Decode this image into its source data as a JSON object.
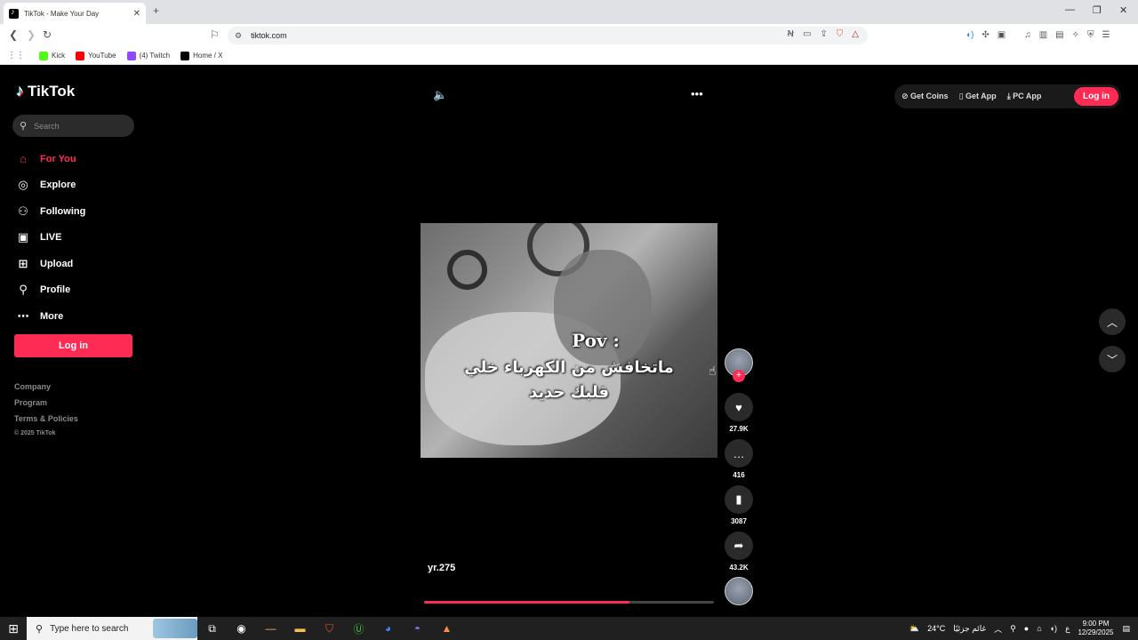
{
  "browser": {
    "tab_title": "TikTok - Make Your Day",
    "tab_close": "✕",
    "new_tab": "+",
    "url": "tiktok.com",
    "bookmarks": [
      {
        "label": "Kick",
        "color": "#53fc18"
      },
      {
        "label": "YouTube",
        "color": "#ff0000"
      },
      {
        "label": "(4) Twitch",
        "color": "#9146ff"
      },
      {
        "label": "Home / X",
        "color": "#000000"
      }
    ]
  },
  "sidebar": {
    "logo": "TikTok",
    "search_placeholder": "Search",
    "nav": [
      {
        "label": "For You",
        "icon": "home-icon"
      },
      {
        "label": "Explore",
        "icon": "compass-icon"
      },
      {
        "label": "Following",
        "icon": "following-icon"
      },
      {
        "label": "LIVE",
        "icon": "live-icon"
      },
      {
        "label": "Upload",
        "icon": "upload-icon"
      },
      {
        "label": "Profile",
        "icon": "profile-icon"
      },
      {
        "label": "More",
        "icon": "more-icon"
      }
    ],
    "login": "Log in",
    "footer": [
      "Company",
      "Program",
      "Terms & Policies"
    ],
    "copyright": "© 2025 TikTok"
  },
  "top_actions": {
    "get_coins": "Get Coins",
    "get_app": "Get App",
    "pc_app": "PC App",
    "login": "Log in"
  },
  "video": {
    "caption_line1": "Pov :",
    "caption_line2": "ماتخافش من الكهرباء خلي",
    "caption_line3": "قلبك حديد",
    "author": "yr.275",
    "description_emoji": "😀",
    "progress_fraction": 0.71
  },
  "actions": {
    "likes": "27.9K",
    "comments": "416",
    "saves": "3087",
    "shares": "43.2K"
  },
  "taskbar": {
    "search_placeholder": "Type here to search",
    "weather": "24°C",
    "weather_text": "غائم جزئيًا",
    "time": "9:00 PM",
    "date": "12/29/2025"
  },
  "colors": {
    "accent": "#fe2c55",
    "background": "#000000"
  }
}
